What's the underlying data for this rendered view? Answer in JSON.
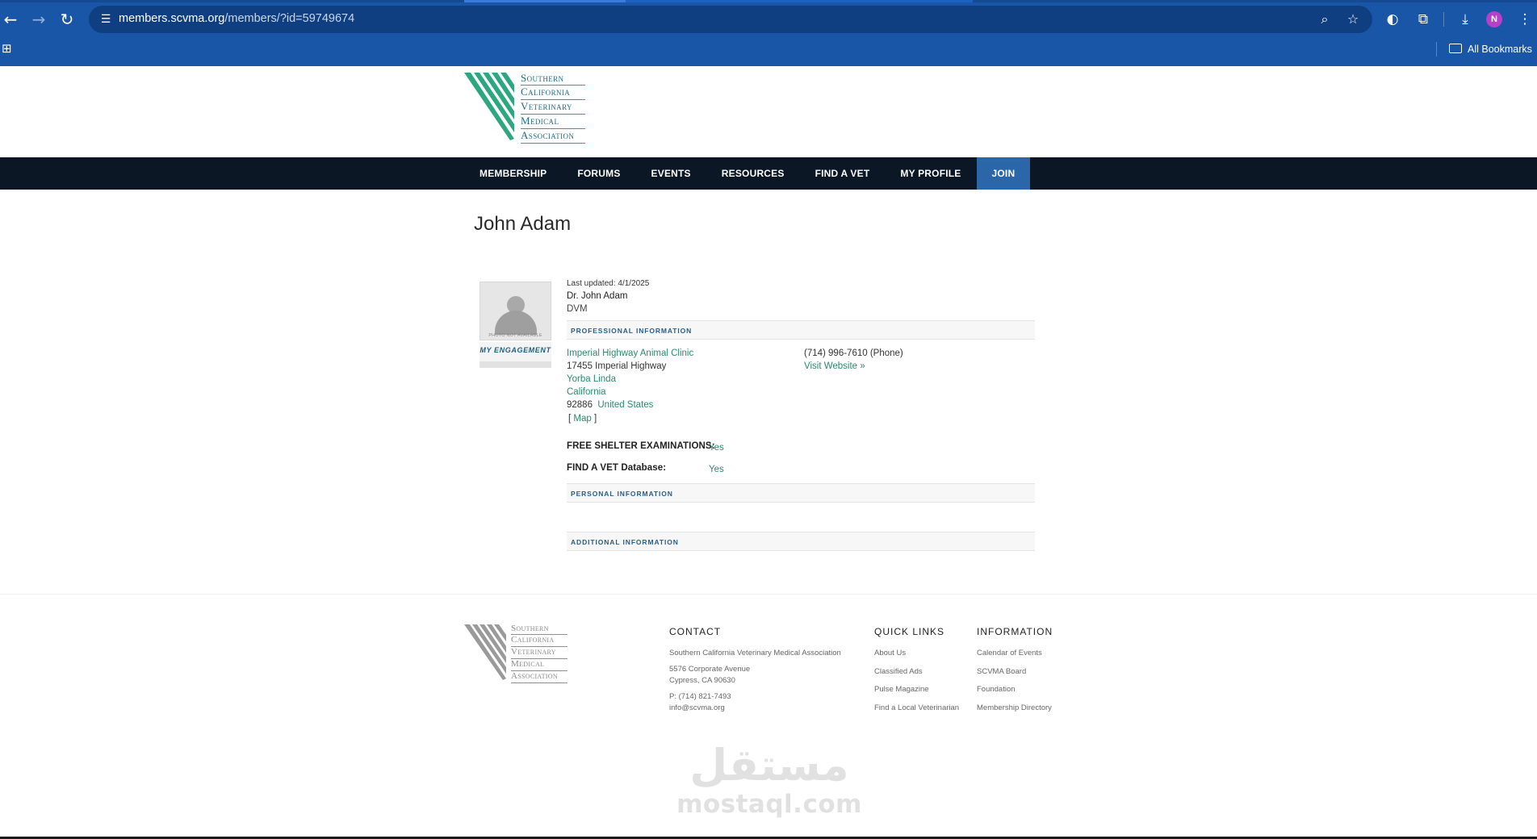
{
  "browser": {
    "url_domain": "members.scvma.org",
    "url_path": "/members/?id=59749674",
    "profile_initial": "N",
    "bookmarks_label": "All Bookmarks"
  },
  "logo": {
    "words": [
      "Southern",
      "California",
      "Veterinary",
      "Medical",
      "Association"
    ]
  },
  "nav": {
    "items": [
      "MEMBERSHIP",
      "FORUMS",
      "EVENTS",
      "RESOURCES",
      "FIND A VET",
      "MY PROFILE",
      "JOIN"
    ]
  },
  "member": {
    "title": "John Adam",
    "photo_placeholder": "PHOTO NOT AVAILABLE",
    "engagement_label": "MY ENGAGEMENT",
    "last_updated": "Last updated: 4/1/2025",
    "display_name": "Dr. John Adam",
    "degree": "DVM"
  },
  "sections": {
    "professional": "PROFESSIONAL INFORMATION",
    "personal": "PERSONAL INFORMATION",
    "additional": "ADDITIONAL INFORMATION"
  },
  "professional": {
    "clinic": "Imperial Highway Animal Clinic",
    "street": "17455 Imperial Highway",
    "city": "Yorba Linda",
    "state": "California",
    "zip": "92886",
    "country": "United States",
    "map_open": "[",
    "map_label": "Map",
    "map_close": "]",
    "phone": "(714) 996-7610 (Phone)",
    "website_label": "Visit Website »",
    "shelter_label": "FREE SHELTER EXAMINATIONS:",
    "shelter_value": "Yes",
    "findavet_label": "FIND A VET Database:",
    "findavet_value": "Yes"
  },
  "footer": {
    "contact": {
      "heading": "CONTACT",
      "org": "Southern California Veterinary Medical Association",
      "address1": "5576 Corporate Avenue",
      "address2": "Cypress, CA 90630",
      "phone": "P: (714) 821-7493",
      "email": "info@scvma.org"
    },
    "quick_links": {
      "heading": "QUICK LINKS",
      "items": [
        "About Us",
        "Classified Ads",
        "Pulse Magazine",
        "Find a Local Veterinarian"
      ]
    },
    "information": {
      "heading": "INFORMATION",
      "items": [
        "Calendar of Events",
        "SCVMA Board",
        "Foundation",
        "Membership Directory"
      ]
    }
  },
  "watermark": {
    "arabic": "مستقل",
    "latin": "mostaql.com"
  },
  "colors": {
    "chrome_blue": "#1a56a8",
    "nav_dark": "#0c1726",
    "join_blue": "#2a66a8",
    "link_green": "#2b8a6b",
    "section_blue": "#2a5d88",
    "logo_green": "#2da77e"
  },
  "icons": {
    "back": "arrow-left-icon",
    "forward": "arrow-right-icon",
    "reload": "reload-icon",
    "site_info": "tune-icon",
    "zoom": "zoom-icon",
    "bookmark": "star-icon",
    "extension_a": "puzzle-icon",
    "download": "download-icon",
    "menu": "kebab-menu-icon",
    "apps": "apps-grid-icon",
    "folder": "folder-icon"
  }
}
